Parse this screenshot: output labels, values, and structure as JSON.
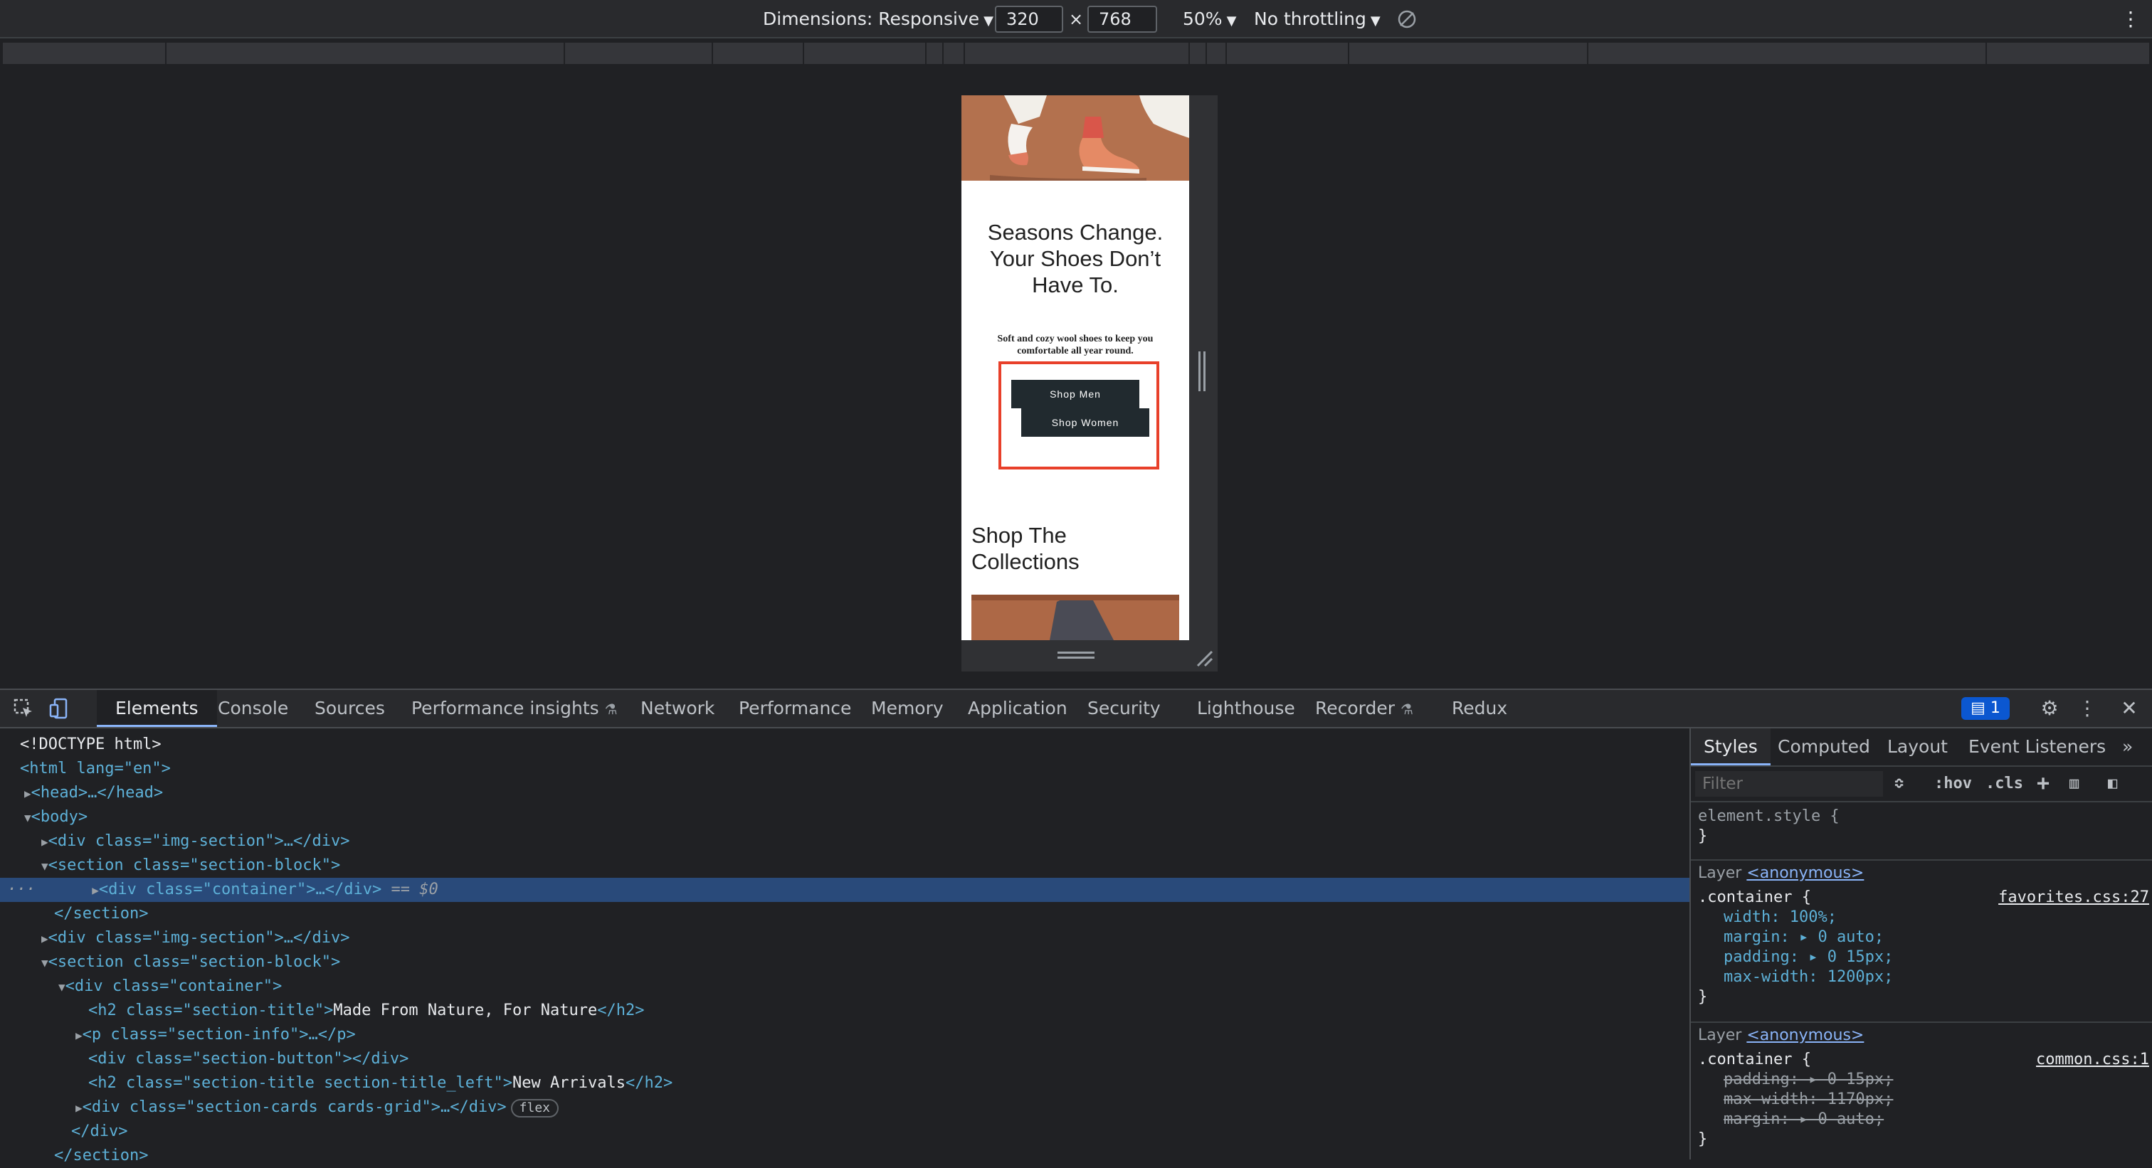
{
  "device_toolbar": {
    "dimensions_label": "Dimensions: Responsive",
    "width": "320",
    "times": "×",
    "height": "768",
    "zoom": "50%",
    "throttle": "No throttling"
  },
  "page": {
    "hero_title": "Seasons Change. Your Shoes Don’t Have To.",
    "hero_info": "Soft and cozy wool shoes to keep you comfortable all year round.",
    "shop_men": "Shop Men",
    "shop_women": "Shop Women",
    "collections_title": "Shop The Collections"
  },
  "devtools": {
    "tabs": [
      "Elements",
      "Console",
      "Sources",
      "Performance insights",
      "Network",
      "Performance",
      "Memory",
      "Application",
      "Security",
      "Lighthouse",
      "Recorder",
      "Redux"
    ],
    "issues_count": "1"
  },
  "elements": {
    "doctype": "<!DOCTYPE html>",
    "html_open": "<html lang=\"en\">",
    "head": "<head>…</head>",
    "body_open": "<body>",
    "selected_suffix": "== $0",
    "lines": {
      "img1": "<div class=\"img-section\">…</div>",
      "sec1_open": "<section class=\"section-block\">",
      "container1": "<div class=\"container\">…</div>",
      "sec1_close": "</section>",
      "img2": "<div class=\"img-section\">…</div>",
      "sec2_open": "<section class=\"section-block\">",
      "container2_open": "<div class=\"container\">",
      "h2_1_open": "<h2 class=\"section-title\">",
      "h2_1_text": "Made From Nature, For Nature",
      "h2_close": "</h2>",
      "p_info": "<p class=\"section-info\">…</p>",
      "button_div": "<div class=\"section-button\"></div>",
      "h2_2_open": "<h2 class=\"section-title section-title_left\">",
      "h2_2_text": "New Arrivals",
      "cards": "<div class=\"section-cards cards-grid\">…</div>",
      "flex_badge": "flex",
      "div_close": "</div>",
      "section_close": "</section>"
    }
  },
  "styles": {
    "tabs": [
      "Styles",
      "Computed",
      "Layout",
      "Event Listeners"
    ],
    "filter_placeholder": "Filter",
    "hov": ":hov",
    "cls": ".cls",
    "element_style": "element.style {",
    "close_brace": "}",
    "layer_label": "Layer",
    "layer_name": "<anonymous>",
    "rule1": {
      "selector": ".container {",
      "source": "favorites.css:27",
      "props": [
        "width: 100%;",
        "margin: ▸ 0 auto;",
        "padding: ▸ 0 15px;",
        "max-width: 1200px;"
      ]
    },
    "rule2": {
      "selector": ".container {",
      "source": "common.css:1",
      "props": [
        "padding: ▸ 0 15px;",
        "max-width: 1170px;",
        "margin: ▸ 0 auto;"
      ]
    }
  }
}
